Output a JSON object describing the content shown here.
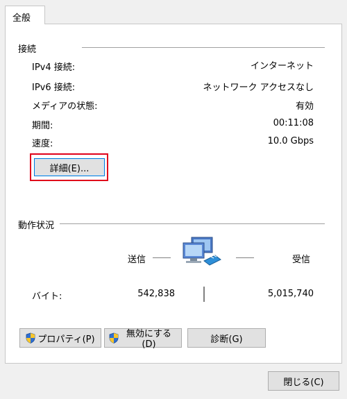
{
  "tab": {
    "label": "全般"
  },
  "connection": {
    "title": "接続",
    "rows": [
      {
        "label": "IPv4 接続:",
        "value": "インターネット"
      },
      {
        "label": "IPv6 接続:",
        "value": "ネットワーク アクセスなし"
      },
      {
        "label": "メディアの状態:",
        "value": "有効"
      },
      {
        "label": "期間:",
        "value": "00:11:08"
      },
      {
        "label": "速度:",
        "value": "10.0 Gbps"
      }
    ],
    "details_button": "詳細(E)..."
  },
  "activity": {
    "title": "動作状況",
    "sent_label": "送信",
    "received_label": "受信",
    "bytes_label": "バイト:",
    "bytes_sent": "542,838",
    "bytes_received": "5,015,740"
  },
  "buttons": {
    "properties": "プロパティ(P)",
    "disable": "無効にする(D)",
    "diagnose": "診断(G)",
    "close": "閉じる(C)"
  },
  "colors": {
    "highlight": "#e0001a",
    "focus": "#0078d7"
  },
  "icons": {
    "shield": "uac-shield-icon",
    "network": "network-computers-icon"
  }
}
